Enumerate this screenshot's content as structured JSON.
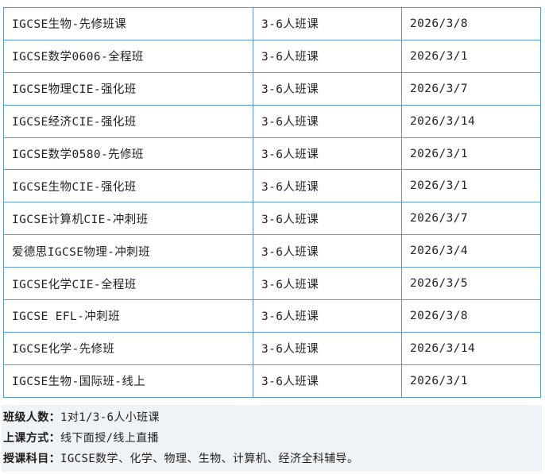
{
  "table": {
    "rows": [
      [
        "IGCSE生物-先修班课",
        "3-6人班课",
        "2026/3/8"
      ],
      [
        "IGCSE数学0606-全程班",
        "3-6人班课",
        "2026/3/1"
      ],
      [
        "IGCSE物理CIE-强化班",
        "3-6人班课",
        "2026/3/7"
      ],
      [
        "IGCSE经济CIE-强化班",
        "3-6人班课",
        "2026/3/14"
      ],
      [
        "IGCSE数学0580-先修班",
        "3-6人班课",
        "2026/3/1"
      ],
      [
        "IGCSE生物CIE-强化班",
        "3-6人班课",
        "2026/3/1"
      ],
      [
        "IGCSE计算机CIE-冲刺班",
        "3-6人班课",
        "2026/3/7"
      ],
      [
        "爱德思IGCSE物理-冲刺班",
        "3-6人班课",
        "2026/3/4"
      ],
      [
        "IGCSE化学CIE-全程班",
        "3-6人班课",
        "2026/3/5"
      ],
      [
        "IGCSE EFL-冲刺班",
        "3-6人班课",
        "2026/3/8"
      ],
      [
        "IGCSE化学-先修班",
        "3-6人班课",
        "2026/3/14"
      ],
      [
        "IGCSE生物-国际班-线上",
        "3-6人班课",
        "2026/3/1"
      ]
    ]
  },
  "info": {
    "class_size_label": "班级人数：",
    "class_size_value": "1对1/3-6人小班课",
    "mode_label": "上课方式：",
    "mode_value": "线下面授/线上直播",
    "subjects_label": "授课科目：",
    "subjects_value": "IGCSE数学、化学、物理、生物、计算机、经济全科辅导。"
  },
  "colors": {
    "border": "#5b9bd5",
    "info_background": "#eef3f8"
  }
}
